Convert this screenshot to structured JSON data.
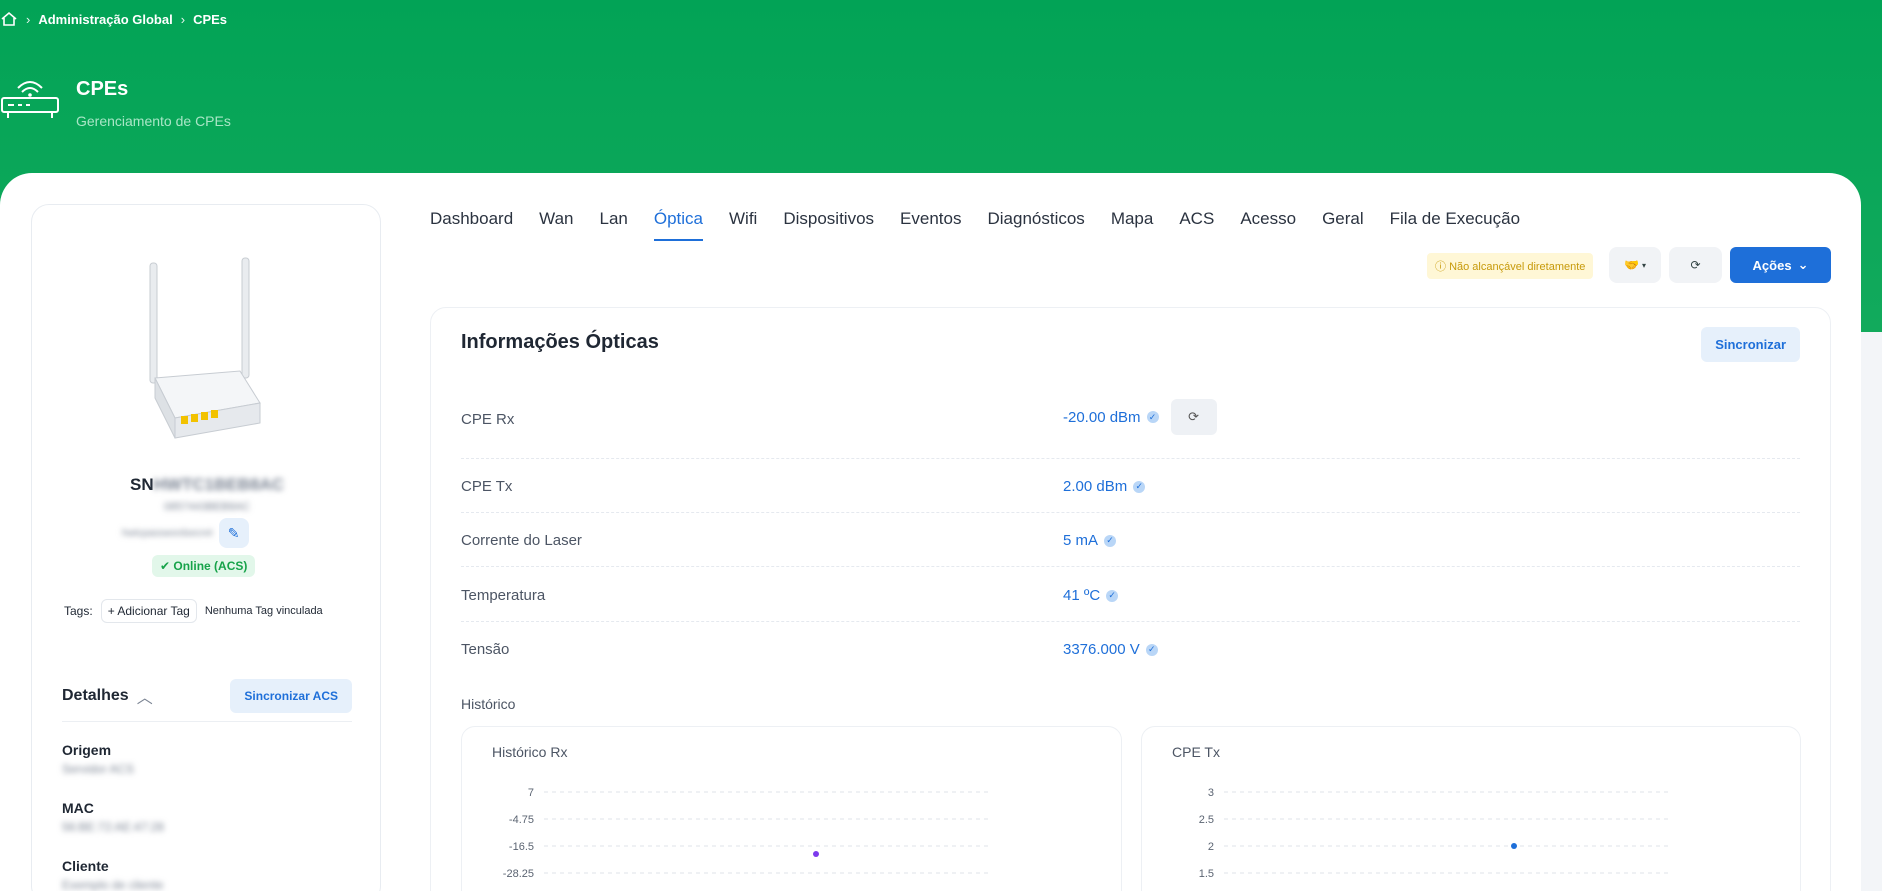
{
  "breadcrumb": {
    "items": [
      "Administração Global",
      "CPEs"
    ]
  },
  "page": {
    "title": "CPEs",
    "subtitle": "Gerenciamento de CPEs"
  },
  "device": {
    "sn_prefix": "SN",
    "sn_value": "HWTC1BEB8AC",
    "model": "0857443BEB8AC",
    "password_mask": "hwtcpasswordsecret",
    "status": "Online (ACS)",
    "tags_label": "Tags:",
    "add_tag": "+ Adicionar Tag",
    "no_tag": "Nenhuma Tag vinculada"
  },
  "details": {
    "title": "Detalhes",
    "sync_label": "Sincronizar ACS",
    "fields": [
      {
        "key": "Origem",
        "value": "Servidor ACS"
      },
      {
        "key": "MAC",
        "value": "56:BE:72:AE:47:28"
      },
      {
        "key": "Cliente",
        "value": "Exemplo de cliente"
      }
    ]
  },
  "tabs": [
    "Dashboard",
    "Wan",
    "Lan",
    "Óptica",
    "Wifi",
    "Dispositivos",
    "Eventos",
    "Diagnósticos",
    "Mapa",
    "ACS",
    "Acesso",
    "Geral",
    "Fila de Execução"
  ],
  "active_tab": "Óptica",
  "toolbar": {
    "warning": "Não alcançável diretamente",
    "actions_label": "Ações"
  },
  "optical": {
    "title": "Informações Ópticas",
    "sync_label": "Sincronizar",
    "rows": [
      {
        "label": "CPE Rx",
        "value": "-20.00 dBm"
      },
      {
        "label": "CPE Tx",
        "value": "2.00 dBm"
      },
      {
        "label": "Corrente do Laser",
        "value": "5 mA"
      },
      {
        "label": "Temperatura",
        "value": "41 ºC"
      },
      {
        "label": "Tensão",
        "value": "3376.000 V"
      }
    ],
    "history_label": "Histórico"
  },
  "colors": {
    "green": "#02a356",
    "blue": "#1e6fd9",
    "rx_point": "#7c3aed",
    "tx_point": "#1e6fd9"
  },
  "chart_data": [
    {
      "type": "line",
      "title": "Histórico Rx",
      "ylim": [
        -28.25,
        7
      ],
      "yticks": [
        "7",
        "-4.75",
        "-16.5",
        "-28.25"
      ],
      "series": [
        {
          "values": [
            -20.0
          ]
        }
      ]
    },
    {
      "type": "line",
      "title": "CPE Tx",
      "ylim": [
        1.5,
        3
      ],
      "yticks": [
        "3",
        "2.5",
        "2",
        "1.5"
      ],
      "series": [
        {
          "values": [
            2.0
          ]
        }
      ]
    }
  ]
}
